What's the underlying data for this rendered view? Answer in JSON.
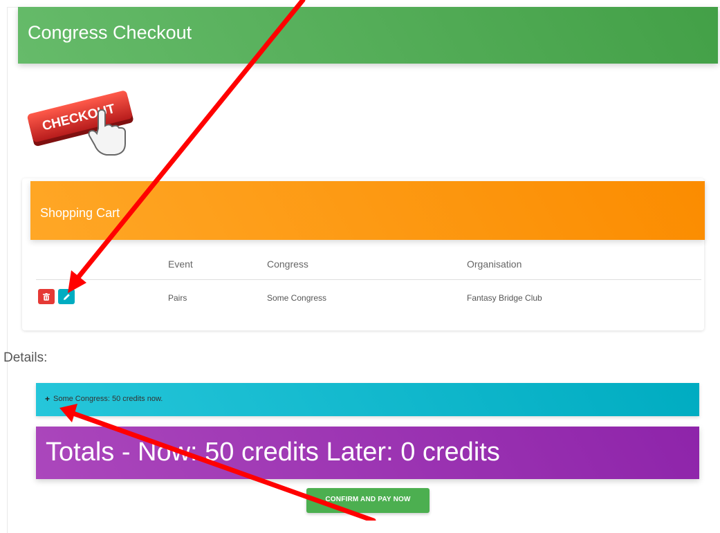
{
  "page": {
    "title": "Congress Checkout"
  },
  "logo": {
    "text": "CHECKOUT",
    "icon": "hand-pointer-icon"
  },
  "cart": {
    "title": "Shopping Cart",
    "columns": [
      "",
      "Event",
      "Congress",
      "Organisation"
    ],
    "rows": [
      {
        "event": "Pairs",
        "congress": "Some Congress",
        "organisation": "Fantasy Bridge Club"
      }
    ],
    "row_actions": {
      "delete_icon": "trash-icon",
      "edit_icon": "pencil-icon"
    }
  },
  "details": {
    "label": "Details:",
    "item_prefix": "+",
    "item_text": "Some Congress: 50 credits now."
  },
  "totals": {
    "text": "Totals - Now: 50 credits Later: 0 credits"
  },
  "confirm_button": {
    "label": "CONFIRM AND PAY NOW"
  },
  "colors": {
    "header": "#4caf50",
    "cart_header": "#fb8c00",
    "detail_bar": "#00acc1",
    "totals": "#8e24aa",
    "delete_button": "#e53935",
    "edit_button": "#00acc1",
    "annotation_arrow": "#ff0000"
  }
}
